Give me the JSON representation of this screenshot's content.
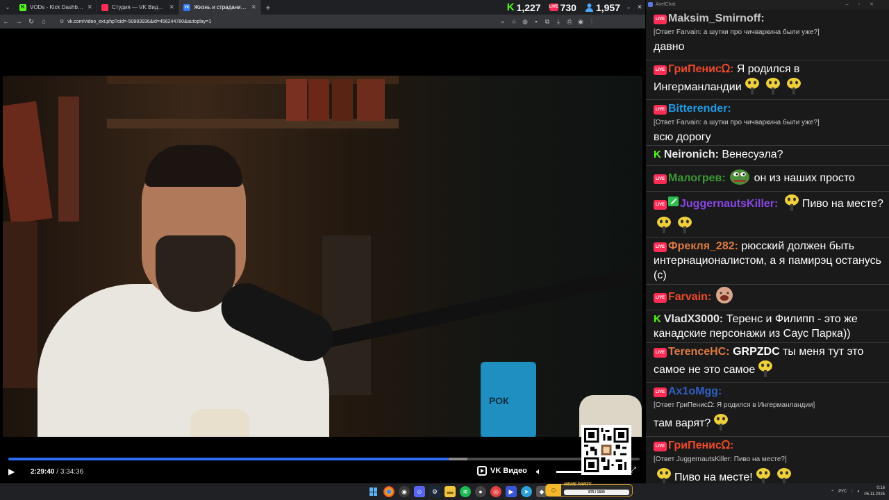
{
  "browser": {
    "tabs": [
      {
        "label": "VODs - Kick Dashboard",
        "fav_color": "#53fc18",
        "fav_glyph": "K",
        "active": false
      },
      {
        "label": "Студия — VK Видео Live",
        "fav_color": "#ff2d55",
        "fav_glyph": "",
        "active": false
      },
      {
        "label": "Жизнь и страдания Романа...",
        "fav_color": "#2f7cf6",
        "fav_glyph": "VK",
        "active": true
      }
    ],
    "url": "vk.com/video_ext.php?oid=-50883936&id=456244780&autoplay=1"
  },
  "counters": {
    "kick": "1,227",
    "vk_live": "730",
    "viewers": "1,957"
  },
  "player": {
    "current_time": "2:29:40",
    "separator": " / ",
    "duration": "3:34:36",
    "progress_fraction": 0.697,
    "buffered_fraction": 0.03,
    "brand": "VK Видео",
    "mug_text": "РОК"
  },
  "chat": {
    "window_title": "AxelChat",
    "messages": [
      {
        "platform": "vk",
        "user": "Maksim_Smirnoff:",
        "color": "#c8c8c8",
        "reply": "[Ответ Farvain: а шутки про чичваркина были уже?]",
        "text": "давно",
        "emotes": 0
      },
      {
        "platform": "vk",
        "user": "ГриПенисᘯ:",
        "color": "#f0492b",
        "reply": "",
        "text": "Я родился в Ингерманландии",
        "emotes": 3
      },
      {
        "platform": "vk",
        "user": "Bitterender:",
        "color": "#1e9be6",
        "reply": "[Ответ Farvain: а шутки про чичваркина были уже?]",
        "text": "всю дорогу",
        "emotes": 0
      },
      {
        "platform": "kick",
        "user": "Neironich:",
        "color": "#e8e8e8",
        "reply": "",
        "text": "Венесуэла?",
        "emotes": 0
      },
      {
        "platform": "vk",
        "user": "Малогрев:",
        "color": "#3c9a33",
        "reply": "",
        "text": "он из наших просто",
        "emotes": 0
      },
      {
        "platform": "vk",
        "user": "JuggernautsKiller:",
        "color": "#8a45e6",
        "reply": "",
        "text": "Пиво на месте?",
        "emotes": 3
      },
      {
        "platform": "vk",
        "user": "Фрекля_282:",
        "color": "#e07a42",
        "reply": "",
        "text": "рюсский должен быть интернационалистом, а я памирэц останусь (с)",
        "emotes": 0
      },
      {
        "platform": "vk",
        "user": "Farvain:",
        "color": "#f0492b",
        "reply": "",
        "text": "",
        "emotes": 0
      },
      {
        "platform": "kick",
        "user": "VladX3000:",
        "color": "#e8e8e8",
        "reply": "",
        "text": "Теренс и Филипп - это же канадские персонажи из Саус Парка))",
        "emotes": 0
      },
      {
        "platform": "vk",
        "user": "TerenceHC:",
        "color": "#e07a42",
        "reply": "",
        "mention": "GRPZDC",
        "text": "ты меня тут это самое не это самое",
        "emotes": 1
      },
      {
        "platform": "vk",
        "user": "Ax1oMgg:",
        "color": "#2f5fc4",
        "reply": "[Ответ ГриПенисᘯ: Я родился в Ингерманландии]",
        "text": "там варят?",
        "emotes": 1
      },
      {
        "platform": "vk",
        "user": "ГриПенисᘯ:",
        "color": "#f0492b",
        "reply": "[Ответ JuggernautsKiller: Пиво на месте?]",
        "text": "Пиво на месте!",
        "emotes": 3
      }
    ],
    "live_badge": "LIVE"
  },
  "taskbar": {
    "meme_party_title": "MEME PARTY",
    "meme_party_progress": "875 / 1500",
    "lang": "РУС",
    "time": "0:16",
    "date": "05.11.2025"
  }
}
